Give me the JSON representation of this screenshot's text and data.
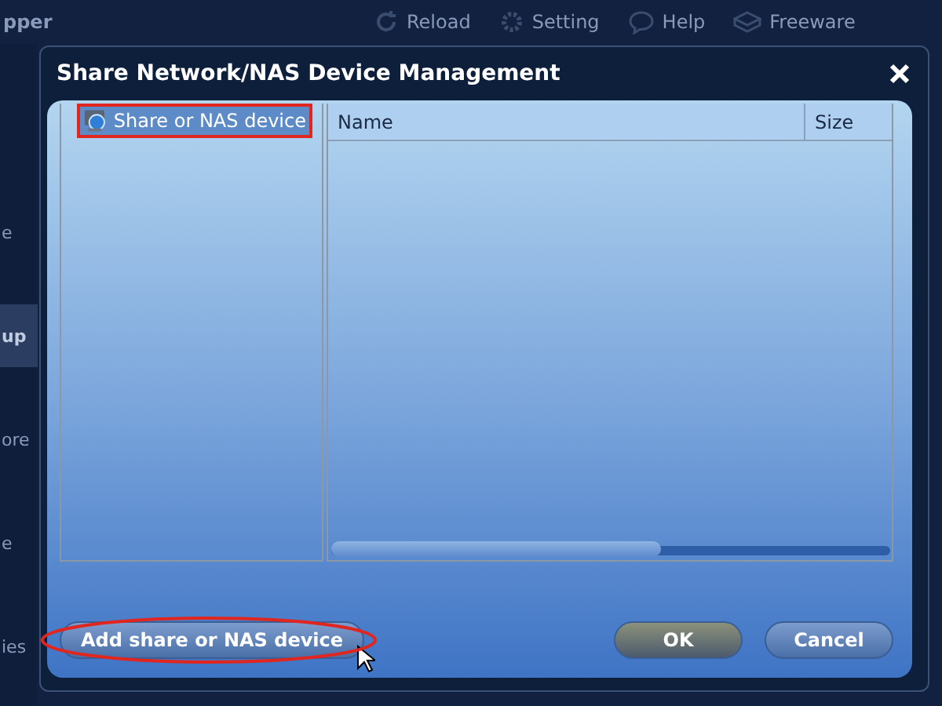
{
  "background_app": {
    "title_fragment": "pper",
    "toolbar": [
      {
        "label": "Reload",
        "kind": "reload"
      },
      {
        "label": "Setting",
        "kind": "setting"
      },
      {
        "label": "Help",
        "kind": "help"
      },
      {
        "label": "Freeware",
        "kind": "freeware"
      }
    ],
    "sidebar": [
      {
        "label": "e",
        "selected": false
      },
      {
        "label": "up",
        "selected": true
      },
      {
        "label": "ore",
        "selected": false
      },
      {
        "label": "e",
        "selected": false
      },
      {
        "label": "ies",
        "selected": false
      }
    ]
  },
  "dialog": {
    "title": "Share Network/NAS Device Management",
    "tree": [
      {
        "label": "Share or NAS device",
        "selected": true,
        "highlighted": true
      }
    ],
    "list": {
      "columns": [
        "Name",
        "Size"
      ]
    },
    "buttons": [
      {
        "label": "Add share or NAS device",
        "kind": "add",
        "highlighted": true
      },
      {
        "label": "OK",
        "kind": "ok",
        "highlighted": false
      },
      {
        "label": "Cancel",
        "kind": "cancel",
        "highlighted": false
      }
    ]
  }
}
